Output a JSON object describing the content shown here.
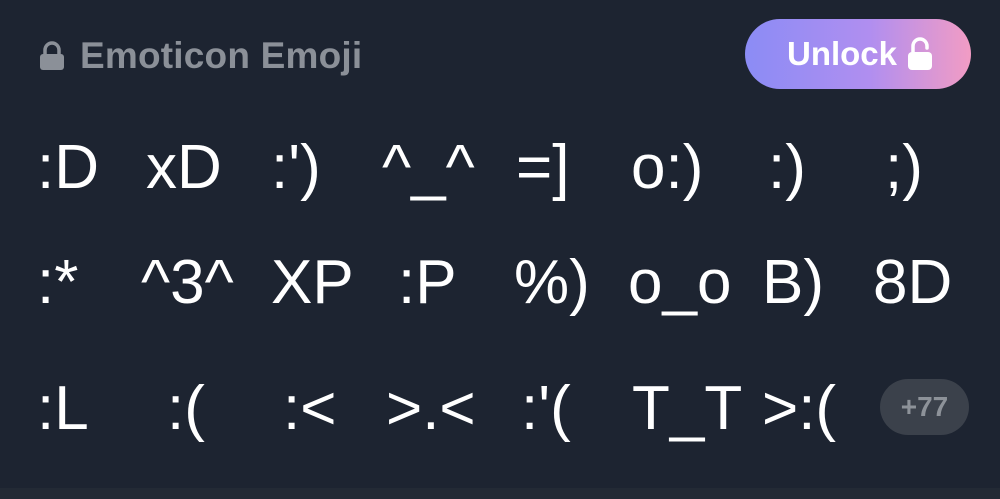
{
  "header": {
    "title": "Emoticon Emoji",
    "lock_icon": "lock-icon"
  },
  "unlock_button": {
    "label": "Unlock",
    "icon": "unlocked-padlock-icon",
    "gradient": [
      "#8b8cf5",
      "#b08ef0",
      "#f29cc4"
    ]
  },
  "emoticons": {
    "rows": [
      [
        ":D",
        "xD",
        ":')",
        "^_^",
        "=]",
        "o:)",
        ":)",
        ";)"
      ],
      [
        ":*",
        "^3^",
        "XP",
        ":P",
        "%)",
        "o_o",
        "B)",
        "8D"
      ],
      [
        ":L",
        ":(",
        ":<",
        ">.<",
        ":'(",
        "T_T",
        ">:("
      ]
    ]
  },
  "more_badge": {
    "label": "+77"
  },
  "colors": {
    "background": "#1d2431",
    "title_gray": "#8b9098",
    "emoticon_text": "#ffffff",
    "badge_bg": "#3b414b"
  }
}
